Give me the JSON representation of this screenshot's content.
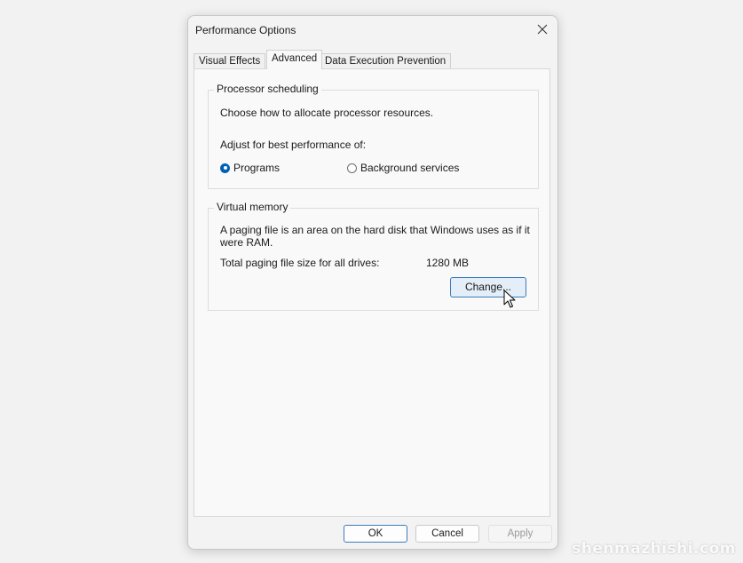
{
  "window": {
    "title": "Performance Options"
  },
  "tabs": [
    {
      "label": "Visual Effects",
      "active": false
    },
    {
      "label": "Advanced",
      "active": true
    },
    {
      "label": "Data Execution Prevention",
      "active": false
    }
  ],
  "processor_scheduling": {
    "title": "Processor scheduling",
    "description": "Choose how to allocate processor resources.",
    "adjust_label": "Adjust for best performance of:",
    "options": [
      {
        "label": "Programs",
        "checked": true
      },
      {
        "label": "Background services",
        "checked": false
      }
    ]
  },
  "virtual_memory": {
    "title": "Virtual memory",
    "description_line1": "A paging file is an area on the hard disk that Windows uses as if it",
    "description_line2": "were RAM.",
    "total_label": "Total paging file size for all drives:",
    "total_value": "1280 MB",
    "change_button": "Change..."
  },
  "buttons": {
    "ok": "OK",
    "cancel": "Cancel",
    "apply": "Apply"
  },
  "watermark": "shenmazhishi.com",
  "colors": {
    "accent": "#005fb8",
    "button_focus_border": "#3d7cbb"
  },
  "icons": {
    "close": "close-icon",
    "cursor": "mouse-pointer-icon"
  }
}
